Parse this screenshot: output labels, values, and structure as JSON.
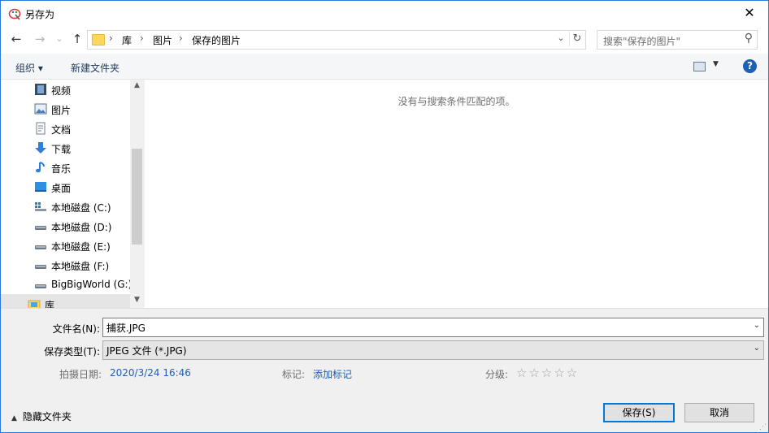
{
  "window": {
    "title": "另存为",
    "close_glyph": "✕"
  },
  "nav": {
    "back_glyph": "←",
    "forward_glyph": "→",
    "recent_glyph": "⌄",
    "up_glyph": "↑",
    "breadcrumbs": [
      "库",
      "图片",
      "保存的图片"
    ],
    "crumb_sep": "›",
    "dropdown_glyph": "⌄",
    "refresh_glyph": "↻",
    "search_placeholder": "搜索\"保存的图片\"",
    "search_glyph": "⚲"
  },
  "toolbar": {
    "organize_label": "组织 ▾",
    "new_folder_label": "新建文件夹",
    "view_dd_glyph": "▼",
    "help_glyph": "?"
  },
  "sidebar": {
    "items": [
      {
        "label": "视频",
        "icon": "video-icon"
      },
      {
        "label": "图片",
        "icon": "pictures-icon"
      },
      {
        "label": "文档",
        "icon": "documents-icon"
      },
      {
        "label": "下载",
        "icon": "downloads-icon"
      },
      {
        "label": "音乐",
        "icon": "music-icon"
      },
      {
        "label": "桌面",
        "icon": "desktop-icon"
      },
      {
        "label": "本地磁盘 (C:)",
        "icon": "drive-c-icon"
      },
      {
        "label": "本地磁盘 (D:)",
        "icon": "drive-icon"
      },
      {
        "label": "本地磁盘 (E:)",
        "icon": "drive-icon"
      },
      {
        "label": "本地磁盘 (F:)",
        "icon": "drive-icon"
      },
      {
        "label": "BigBigWorld (G:)",
        "icon": "drive-icon"
      },
      {
        "label": "库",
        "icon": "library-icon"
      }
    ],
    "scroll_up_glyph": "▲",
    "scroll_down_glyph": "▼"
  },
  "content": {
    "empty_message": "没有与搜索条件匹配的项。"
  },
  "form": {
    "filename_label": "文件名(N):",
    "filename_value": "捕获.JPG",
    "filetype_label": "保存类型(T):",
    "filetype_value": "JPEG 文件 (*.JPG)",
    "dropdown_glyph": "⌄",
    "date_label": "拍摄日期:",
    "date_value": "2020/3/24 16:46",
    "tags_label": "标记:",
    "tags_value": "添加标记",
    "rating_label": "分级:",
    "rating_stars": "☆☆☆☆☆",
    "hide_folders_caret": "▲",
    "hide_folders_label": "隐藏文件夹",
    "save_label": "保存(S)",
    "cancel_label": "取消",
    "grip_glyph": "⋰"
  },
  "colors": {
    "accent": "#0078d7",
    "link": "#1c5fb5",
    "folder": "#ffd75e"
  }
}
